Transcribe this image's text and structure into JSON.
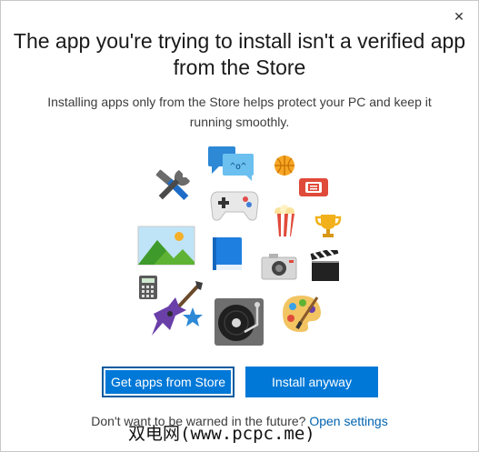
{
  "dialog": {
    "close_symbol": "✕",
    "title": "The app you're trying to install isn't a verified app from the Store",
    "subtitle": "Installing apps only from the Store helps protect your PC and keep it running smoothly.",
    "primary_button": "Get apps from Store",
    "secondary_button": "Install anyway",
    "footer_text": "Don't want to be warned in the future?",
    "footer_link": "Open settings",
    "chat_bubble_text": "^o^",
    "watermark": "双电网(www.pcpc.me)"
  },
  "icons": [
    "chat-bubbles-icon",
    "basketball-icon",
    "tools-icon",
    "gamepad-icon",
    "ticket-icon",
    "popcorn-icon",
    "trophy-icon",
    "landscape-photo-icon",
    "book-icon",
    "camera-icon",
    "clapperboard-icon",
    "calculator-icon",
    "guitar-icon",
    "star-icon",
    "turntable-icon",
    "palette-icon"
  ],
  "colors": {
    "accent": "#0078d7",
    "link": "#0063b1"
  }
}
